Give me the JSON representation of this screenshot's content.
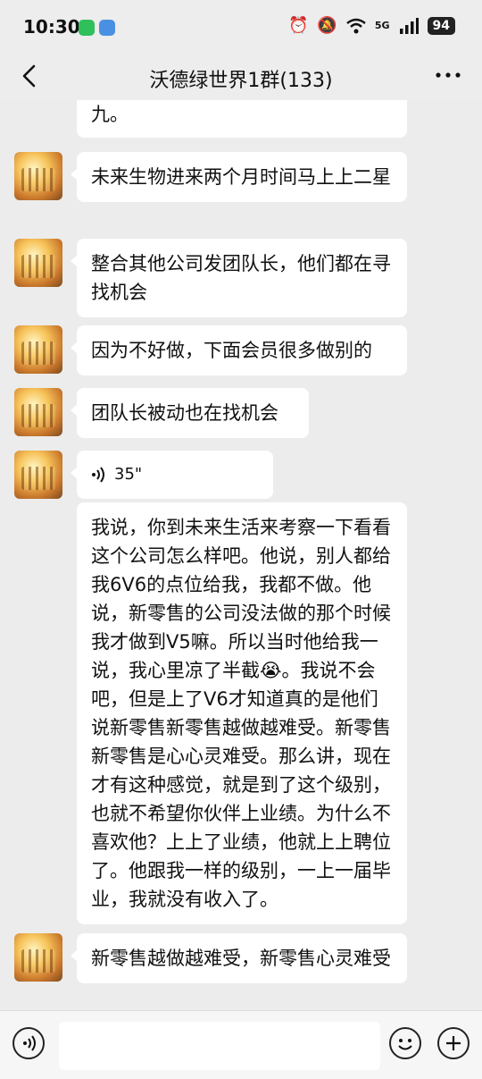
{
  "status": {
    "time": "10:30",
    "network": "5G",
    "battery": "94",
    "icons": [
      "alarm-icon",
      "mute-icon",
      "wifi-icon",
      "signal-icon"
    ]
  },
  "nav": {
    "title": "沃德绿世界1群(133)",
    "back_icon": "chevron-left-icon",
    "more_icon": "more-icon"
  },
  "messages": [
    {
      "type": "text",
      "text": "九。"
    },
    {
      "type": "text",
      "text": "未来生物进来两个月时间马上上二星"
    },
    {
      "type": "text",
      "text": "整合其他公司发团队长，他们都在寻找机会"
    },
    {
      "type": "text",
      "text": "因为不好做，下面会员很多做别的"
    },
    {
      "type": "text",
      "text": "团队长被动也在找机会"
    },
    {
      "type": "voice",
      "duration": "35\""
    },
    {
      "type": "text",
      "text": "我说，你到未来生活来考察一下看看这个公司怎么样吧。他说，别人都给我6V6的点位给我，我都不做。他说，新零售的公司没法做的那个时候我才做到V5嘛。所以当时他给我一说，我心里凉了半截😭。我说不会吧，但是上了V6才知道真的是他们说新零售新零售越做越难受。新零售新零售是心心灵难受。那么讲，现在才有这种感觉，就是到了这个级别，也就不希望你伙伴上业绩。为什么不喜欢他？上上了业绩，他就上上聘位了。他跟我一样的级别，一上一届毕业，我就没有收入了。"
    },
    {
      "type": "text",
      "text": "新零售越做越难受，新零售心灵难受"
    }
  ],
  "input": {
    "voice_icon": "voice-input-icon",
    "emoji_icon": "emoji-icon",
    "plus_icon": "plus-icon"
  }
}
